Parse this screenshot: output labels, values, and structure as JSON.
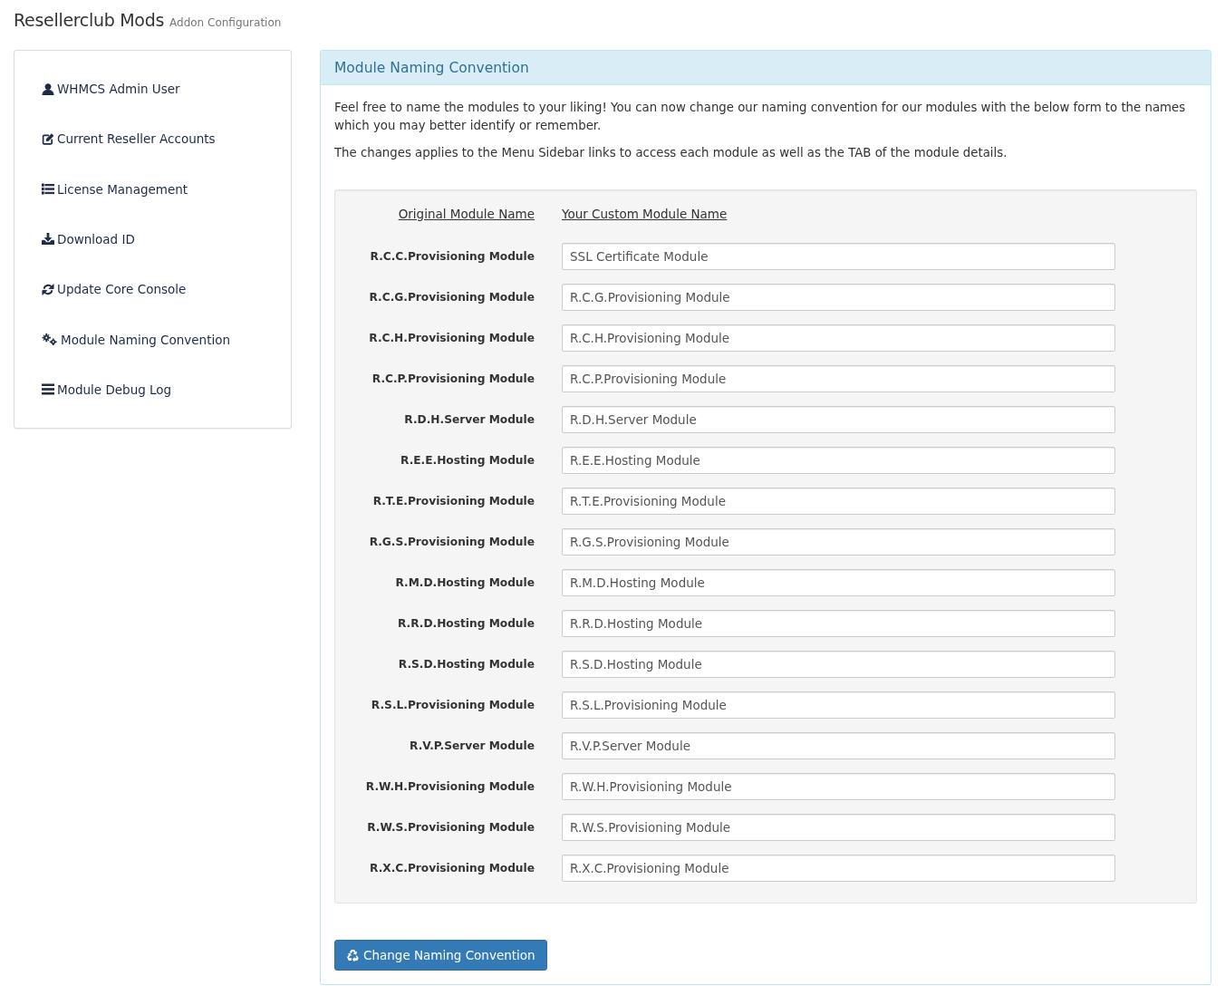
{
  "header": {
    "title": "Resellerclub Mods",
    "subtitle": "Addon Configuration"
  },
  "sidebar": {
    "items": [
      {
        "label": "WHMCS Admin User"
      },
      {
        "label": "Current Reseller Accounts"
      },
      {
        "label": "License Management"
      },
      {
        "label": "Download ID"
      },
      {
        "label": "Update Core Console"
      },
      {
        "label": "Module Naming Convention"
      },
      {
        "label": "Module Debug Log"
      }
    ]
  },
  "panel": {
    "title": "Module Naming Convention",
    "paragraphs": [
      "Feel free to name the modules to your liking! You can now change our naming convention for our modules with the below form to the names which you may better identify or remember.",
      "The changes applies to the Menu Sidebar links to access each module as well as the TAB of the module details."
    ],
    "form": {
      "columns": [
        "Original Module Name",
        "Your Custom Module Name"
      ],
      "rows": [
        {
          "original": "R.C.C.Provisioning Module",
          "value": "SSL Certificate Module"
        },
        {
          "original": "R.C.G.Provisioning Module",
          "value": "R.C.G.Provisioning Module"
        },
        {
          "original": "R.C.H.Provisioning Module",
          "value": "R.C.H.Provisioning Module"
        },
        {
          "original": "R.C.P.Provisioning Module",
          "value": "R.C.P.Provisioning Module"
        },
        {
          "original": "R.D.H.Server Module",
          "value": "R.D.H.Server Module"
        },
        {
          "original": "R.E.E.Hosting Module",
          "value": "R.E.E.Hosting Module"
        },
        {
          "original": "R.T.E.Provisioning Module",
          "value": "R.T.E.Provisioning Module"
        },
        {
          "original": "R.G.S.Provisioning Module",
          "value": "R.G.S.Provisioning Module"
        },
        {
          "original": "R.M.D.Hosting Module",
          "value": "R.M.D.Hosting Module"
        },
        {
          "original": "R.R.D.Hosting Module",
          "value": "R.R.D.Hosting Module"
        },
        {
          "original": "R.S.D.Hosting Module",
          "value": "R.S.D.Hosting Module"
        },
        {
          "original": "R.S.L.Provisioning Module",
          "value": "R.S.L.Provisioning Module"
        },
        {
          "original": "R.V.P.Server Module",
          "value": "R.V.P.Server Module"
        },
        {
          "original": "R.W.H.Provisioning Module",
          "value": "R.W.H.Provisioning Module"
        },
        {
          "original": "R.W.S.Provisioning Module",
          "value": "R.W.S.Provisioning Module"
        },
        {
          "original": "R.X.C.Provisioning Module",
          "value": "R.X.C.Provisioning Module"
        }
      ]
    },
    "submit_button": {
      "label": "Change Naming Convention"
    }
  }
}
